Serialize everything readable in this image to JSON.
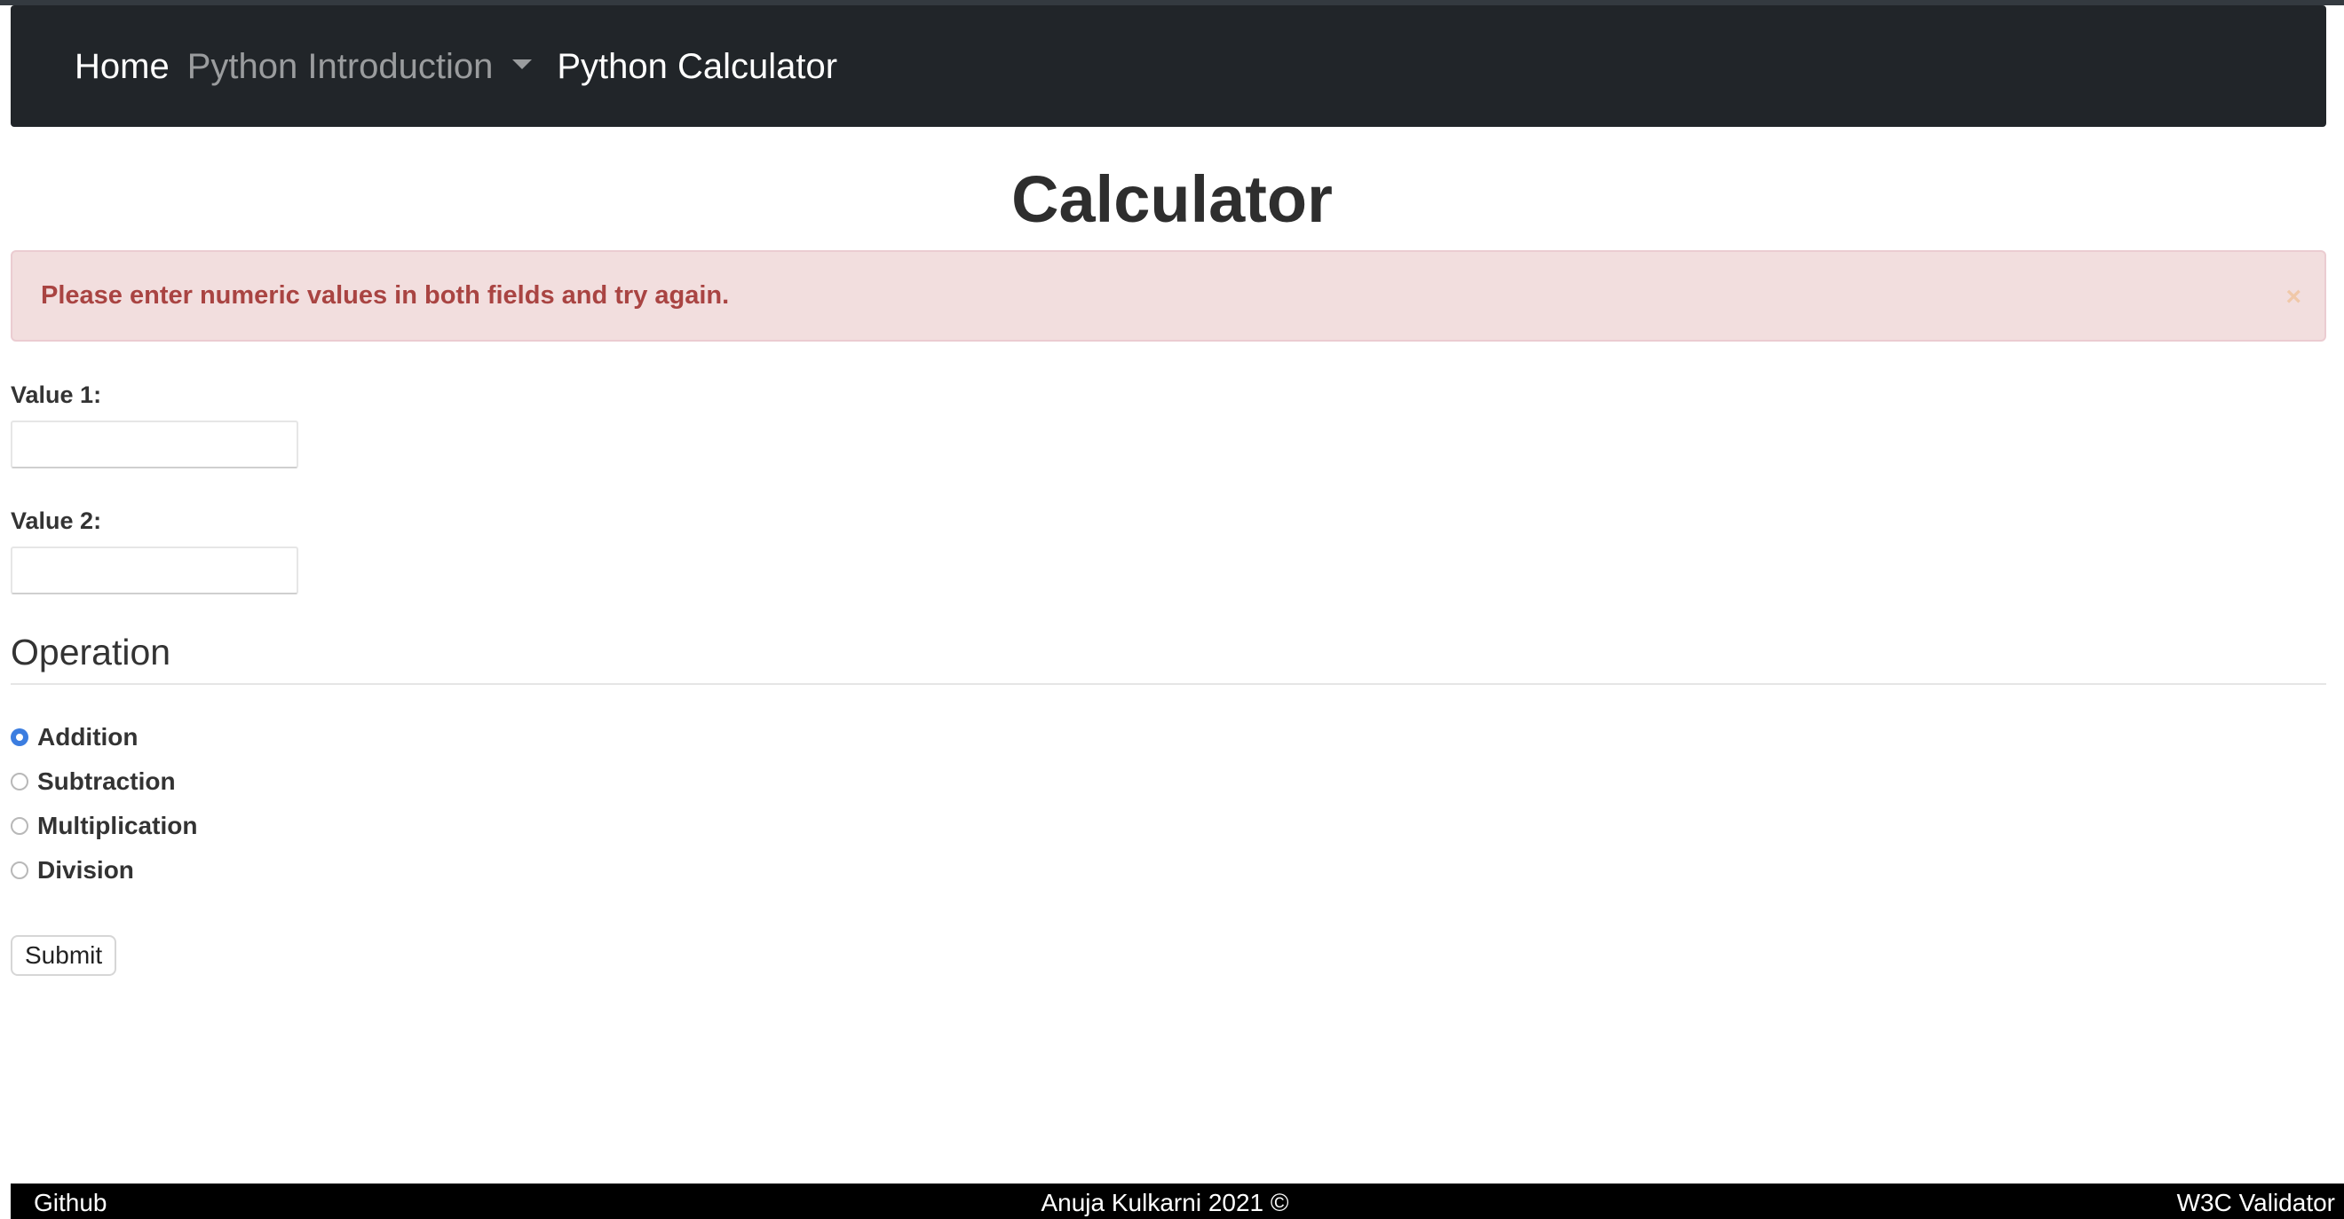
{
  "navbar": {
    "home": "Home",
    "dropdown": "Python Introduction",
    "active": "Python Calculator"
  },
  "title": "Calculator",
  "alert": {
    "message": "Please enter numeric values in both fields and try again.",
    "close": "×"
  },
  "form": {
    "value1_label": "Value 1:",
    "value1": "",
    "value2_label": "Value 2:",
    "value2": "",
    "operation_legend": "Operation",
    "operations": [
      {
        "label": "Addition",
        "checked": true
      },
      {
        "label": "Subtraction",
        "checked": false
      },
      {
        "label": "Multiplication",
        "checked": false
      },
      {
        "label": "Division",
        "checked": false
      }
    ],
    "submit": "Submit"
  },
  "footer": {
    "left": "Github",
    "center": "Anuja Kulkarni 2021 ©",
    "right": "W3C Validator"
  },
  "colors": {
    "navbar_bg": "#212529",
    "alert_bg": "#f2dede",
    "alert_text": "#a94442",
    "radio_checked": "#3b7de0",
    "footer_bg": "#000000"
  }
}
